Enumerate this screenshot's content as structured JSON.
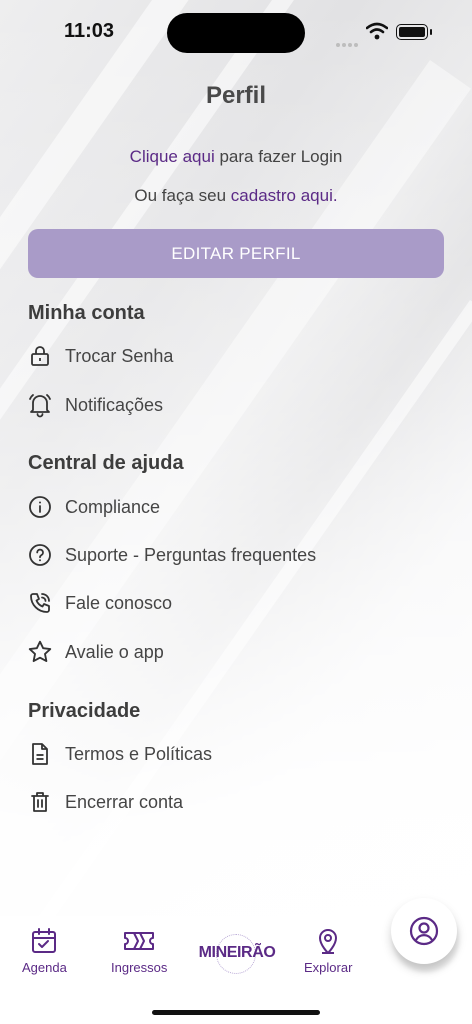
{
  "status": {
    "time": "11:03"
  },
  "header": {
    "title": "Perfil"
  },
  "login": {
    "link_text": "Clique aqui",
    "link_suffix": " para fazer Login",
    "register_prefix": "Ou faça seu ",
    "register_link": "cadastro aqui."
  },
  "edit_button": "EDITAR PERFIL",
  "sections": {
    "account": {
      "title": "Minha conta",
      "items": [
        {
          "label": "Trocar Senha",
          "icon": "lock-icon"
        },
        {
          "label": "Notificações",
          "icon": "bell-icon"
        }
      ]
    },
    "help": {
      "title": "Central de ajuda",
      "items": [
        {
          "label": "Compliance",
          "icon": "info-icon"
        },
        {
          "label": "Suporte - Perguntas frequentes",
          "icon": "question-icon"
        },
        {
          "label": "Fale conosco",
          "icon": "phone-icon"
        },
        {
          "label": "Avalie o app",
          "icon": "star-icon"
        }
      ]
    },
    "privacy": {
      "title": "Privacidade",
      "items": [
        {
          "label": "Termos e Políticas",
          "icon": "document-icon"
        },
        {
          "label": "Encerrar conta",
          "icon": "trash-icon"
        }
      ]
    }
  },
  "tabbar": {
    "agenda": "Agenda",
    "ingressos": "Ingressos",
    "logo": "MINEIRÃO",
    "explorar": "Explorar",
    "profile_icon": "user-circle-icon"
  },
  "colors": {
    "accent": "#5b2a86",
    "button": "#a99bc8"
  }
}
